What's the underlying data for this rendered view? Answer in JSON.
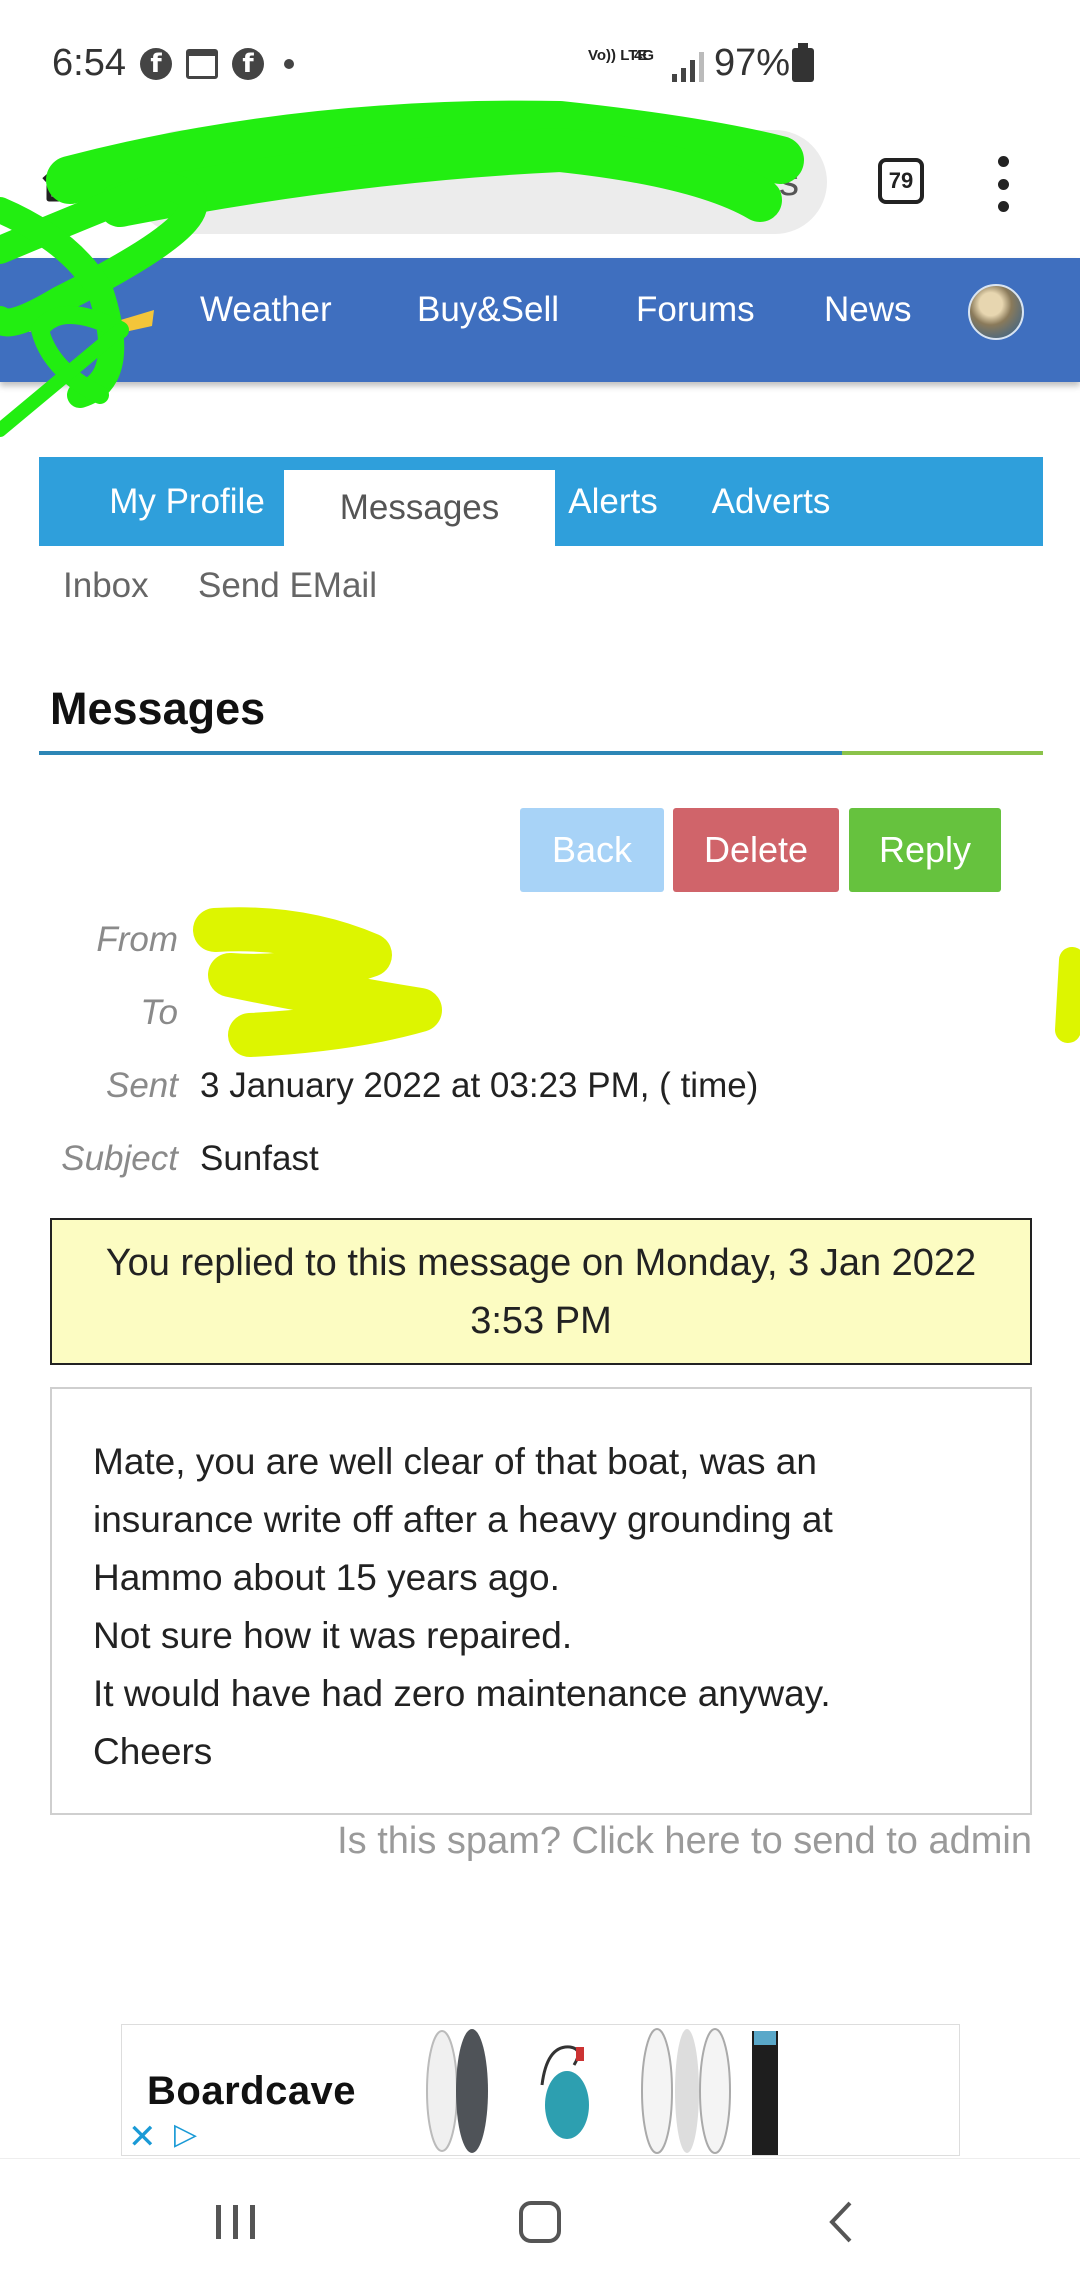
{
  "status_bar": {
    "time": "6:54",
    "network": "Vo)) LTE",
    "network_type": "4G",
    "battery": "97%"
  },
  "browser": {
    "url_visible_fragment": "ers",
    "tab_count": "79"
  },
  "site_nav": {
    "items": [
      "Weather",
      "Buy&Sell",
      "Forums",
      "News"
    ]
  },
  "profile_tabs": {
    "items": [
      "My Profile",
      "Messages",
      "Alerts",
      "Adverts"
    ],
    "active": "Messages"
  },
  "sub_tabs": [
    "Inbox",
    "Send EMail"
  ],
  "page_title": "Messages",
  "actions": {
    "back": "Back",
    "delete": "Delete",
    "reply": "Reply"
  },
  "message": {
    "from_label": "From",
    "to_label": "To",
    "sent_label": "Sent",
    "sent_value": "3 January 2022 at 03:23 PM, ( time)",
    "subject_label": "Subject",
    "subject_value": "Sunfast",
    "reply_notice_line1": "You replied to this message on Monday, 3 Jan 2022",
    "reply_notice_line2": "3:53 PM",
    "body_lines": [
      "Mate, you are well clear of that boat, was an",
      "insurance write off after a heavy grounding at",
      "Hammo about 15 years ago.",
      "Not sure how it was repaired.",
      "It would have had zero maintenance anyway.",
      "Cheers"
    ],
    "spam_link": "Is this spam? Click here to send to admin"
  },
  "ad": {
    "brand": "Boardcave"
  },
  "colors": {
    "site_nav": "#3f6fbf",
    "profile_tabs": "#2f9fdb",
    "back_button": "#a8d3f7",
    "delete_button": "#d0646a",
    "reply_button": "#66c23e",
    "notice_background": "#fcfcc2"
  }
}
